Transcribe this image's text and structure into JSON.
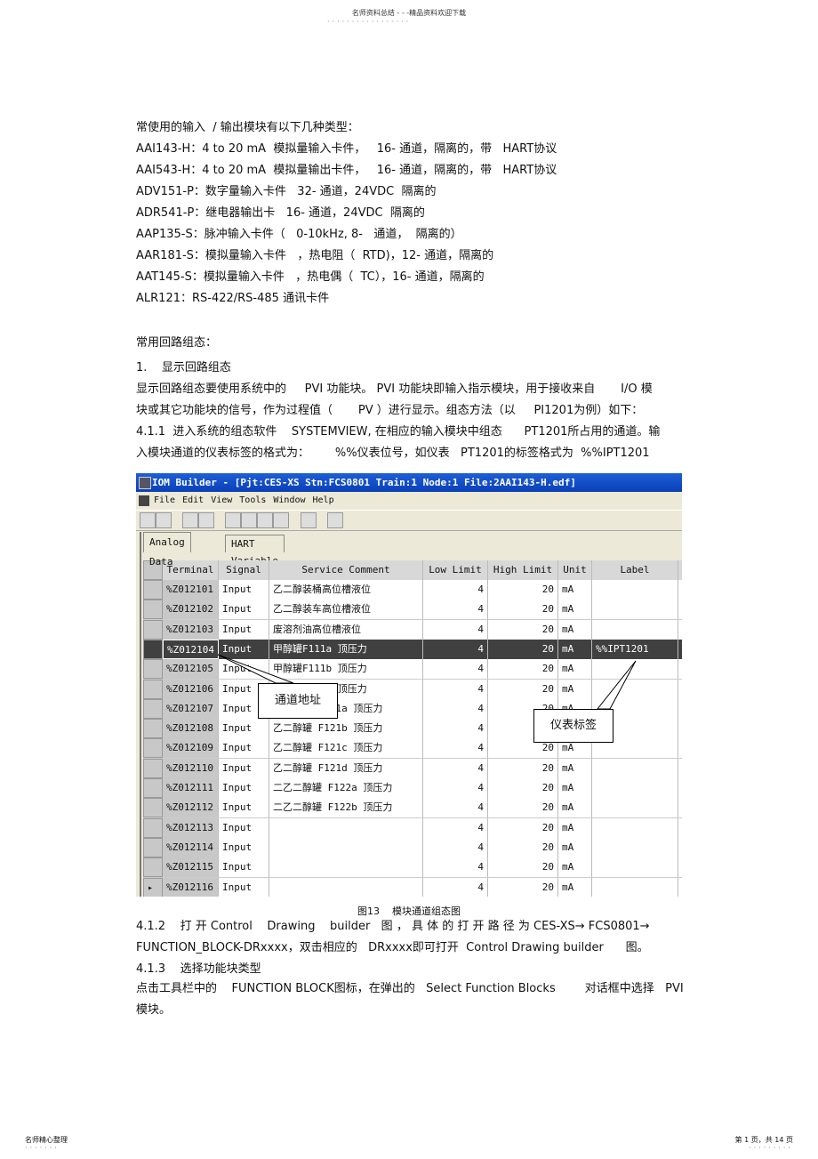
{
  "header": {
    "text": "名师资料总结 - - -精品资料欢迎下载"
  },
  "body": {
    "lines": [
      "常使用的输入  / 输出模块有以下几种类型：",
      "AAI143-H：4 to 20 mA  模拟量输入卡件，   16- 通道，隔离的，带   HART协议",
      "AAI543-H：4 to 20 mA  模拟量输出卡件，   16- 通道，隔离的，带   HART协议",
      "ADV151-P：数字量输入卡件   32- 通道，24VDC  隔离的",
      "ADR541-P：继电器输出卡   16- 通道，24VDC  隔离的",
      "AAP135-S：脉冲输入卡件（   0-10kHz, 8-   通道，  隔离的）",
      "AAR181-S：模拟量输入卡件   ，热电阻（  RTD)，12- 通道，隔离的",
      "AAT145-S：模拟量输入卡件   ，热电偶（  TC），16- 通道，隔离的",
      "ALR121：RS-422/RS-485 通讯卡件"
    ],
    "lines2": [
      "常用回路组态：",
      "1.    显示回路组态",
      "显示回路组态要使用系统中的     PVI 功能块。 PVI 功能块即输入指示模块，用于接收来自       I/O 模",
      "块或其它功能块的信号，作为过程值（       PV ）进行显示。组态方法（以     PI1201为例）如下：",
      "4.1.1  进入系统的组态软件    SYSTEMVIEW, 在相应的输入模块中组态      PT1201所占用的通道。输",
      "入模块通道的仪表标签的格式为：       %%仪表位号，如仪表   PT1201的标签格式为  %%IPT1201"
    ],
    "caption": "图13    模块通道组态图",
    "lines3": [
      "4.1.2    打 开 Control    Drawing    builder   图 ， 具 体 的 打 开 路 径 为 CES-XS→ FCS0801→",
      "FUNCTION_BLOCK-DRxxxx，双击相应的   DRxxxx即可打开  Control Drawing builder      图。",
      "4.1.3    选择功能块类型",
      "点击工具栏中的    FUNCTION BLOCK图标，在弹出的   Select Function Blocks        对话框中选择   PVI",
      "模块。"
    ]
  },
  "window": {
    "title": "IOM Builder - [Pjt:CES-XS Stn:FCS0801 Train:1 Node:1 File:2AAI143-H.edf]",
    "menu": [
      "File",
      "Edit",
      "View",
      "Tools",
      "Window",
      "Help"
    ],
    "toolbar": [
      "open-icon",
      "save-icon",
      "print-icon",
      "print-preview-icon",
      "cut-icon",
      "copy-icon",
      "paste-icon",
      "undo-icon",
      "properties-icon",
      "terminal-icon"
    ],
    "tabs": [
      "Analog Data",
      "HART Variable"
    ],
    "columns": [
      "Terminal",
      "Signal",
      "Service Comment",
      "Low Limit",
      "High Limit",
      "Unit",
      "Label"
    ],
    "rows": [
      [
        "%Z012101",
        "Input",
        "乙二醇装桶高位槽液位",
        "4",
        "20",
        "mA",
        ""
      ],
      [
        "%Z012102",
        "Input",
        "乙二醇装车高位槽液位",
        "4",
        "20",
        "mA",
        ""
      ],
      [
        "%Z012103",
        "Input",
        "废溶剂油高位槽液位",
        "4",
        "20",
        "mA",
        ""
      ],
      [
        "%Z012104",
        "Input",
        "甲醇罐F111a 顶压力",
        "4",
        "20",
        "mA",
        "%%IPT1201"
      ],
      [
        "%Z012105",
        "Input",
        "甲醇罐F111b 顶压力",
        "4",
        "20",
        "mA",
        ""
      ],
      [
        "%Z012106",
        "Input",
        "甲醇罐F111c 顶压力",
        "4",
        "20",
        "mA",
        ""
      ],
      [
        "%Z012107",
        "Input",
        "乙二醇罐    F121a 顶压力",
        "4",
        "20",
        "mA",
        ""
      ],
      [
        "%Z012108",
        "Input",
        "乙二醇罐    F121b 顶压力",
        "4",
        "20",
        "mA",
        ""
      ],
      [
        "%Z012109",
        "Input",
        "乙二醇罐    F121c 顶压力",
        "4",
        "20",
        "mA",
        ""
      ],
      [
        "%Z012110",
        "Input",
        "乙二醇罐    F121d 顶压力",
        "4",
        "20",
        "mA",
        ""
      ],
      [
        "%Z012111",
        "Input",
        "二乙二醇罐  F122a 顶压力",
        "4",
        "20",
        "mA",
        ""
      ],
      [
        "%Z012112",
        "Input",
        "二乙二醇罐  F122b 顶压力",
        "4",
        "20",
        "mA",
        ""
      ],
      [
        "%Z012113",
        "Input",
        "",
        "4",
        "20",
        "mA",
        ""
      ],
      [
        "%Z012114",
        "Input",
        "",
        "4",
        "20",
        "mA",
        ""
      ],
      [
        "%Z012115",
        "Input",
        "",
        "4",
        "20",
        "mA",
        ""
      ],
      [
        "%Z012116",
        "Input",
        "",
        "4",
        "20",
        "mA",
        ""
      ]
    ],
    "selected_row": 4,
    "highlight_color": "#404040",
    "callouts": {
      "address": "通道地址",
      "label": "仪表标签"
    }
  },
  "footer": {
    "left": "名师精心整理",
    "right": "第 1 页，共 14 页"
  }
}
